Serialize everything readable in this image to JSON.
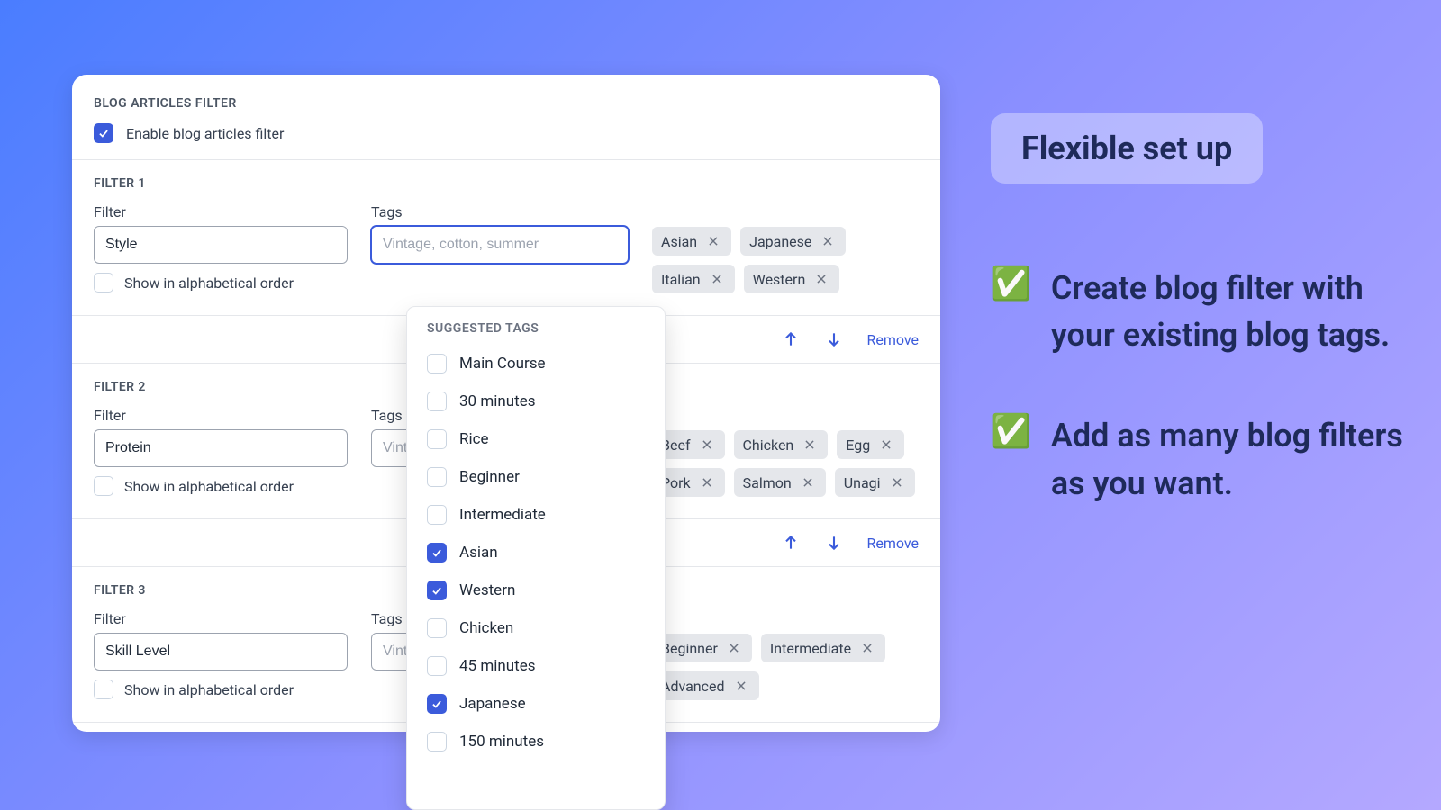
{
  "header": {
    "eyebrow": "BLOG ARTICLES FILTER",
    "enable_label": "Enable blog articles filter",
    "enable_checked": true
  },
  "labels": {
    "filter": "Filter",
    "tags": "Tags",
    "alpha": "Show in alphabetical order",
    "remove": "Remove"
  },
  "tags_placeholder": "Vintage, cotton, summer",
  "filters": [
    {
      "eyebrow": "FILTER 1",
      "name": "Style",
      "alpha_checked": false,
      "tags_focused": true,
      "chips": [
        "Asian",
        "Japanese",
        "Italian",
        "Western"
      ]
    },
    {
      "eyebrow": "FILTER 2",
      "name": "Protein",
      "alpha_checked": false,
      "tags_focused": false,
      "chips": [
        "Beef",
        "Chicken",
        "Egg",
        "Pork",
        "Salmon",
        "Unagi"
      ]
    },
    {
      "eyebrow": "FILTER 3",
      "name": "Skill Level",
      "alpha_checked": false,
      "tags_focused": false,
      "chips": [
        "Beginner",
        "Intermediate",
        "Advanced"
      ]
    }
  ],
  "suggested": {
    "eyebrow": "SUGGESTED TAGS",
    "items": [
      {
        "label": "Main Course",
        "checked": false
      },
      {
        "label": "30 minutes",
        "checked": false
      },
      {
        "label": "Rice",
        "checked": false
      },
      {
        "label": "Beginner",
        "checked": false
      },
      {
        "label": "Intermediate",
        "checked": false
      },
      {
        "label": "Asian",
        "checked": true
      },
      {
        "label": "Western",
        "checked": true
      },
      {
        "label": "Chicken",
        "checked": false
      },
      {
        "label": "45 minutes",
        "checked": false
      },
      {
        "label": "Japanese",
        "checked": true
      },
      {
        "label": "150 minutes",
        "checked": false
      }
    ]
  },
  "promo": {
    "badge": "Flexible set up",
    "bullets": [
      "Create blog filter with your existing blog tags.",
      "Add as many blog filters as you want."
    ]
  }
}
